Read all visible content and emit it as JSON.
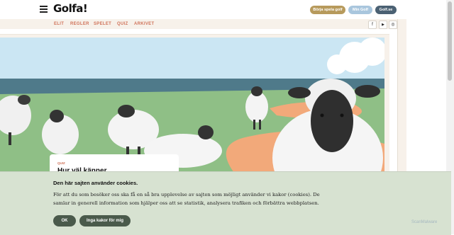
{
  "header": {
    "logo": "Golfa!",
    "buttons": [
      "Börja spela golf",
      "Min Golf",
      "Golf.se"
    ]
  },
  "subnav": {
    "links": [
      "ELIT",
      "REGLER",
      "SPELET",
      "QUIZ",
      "ARKIVET"
    ],
    "social": [
      {
        "icon": "facebook-icon",
        "glyph": "f"
      },
      {
        "icon": "youtube-icon",
        "glyph": "▶"
      },
      {
        "icon": "instagram-icon",
        "glyph": "◎"
      }
    ]
  },
  "article_card": {
    "label": "QUIZ",
    "title": "Hur väl känner"
  },
  "cookie_banner": {
    "title": "Den här sajten använder cookies.",
    "text_line1": "För att du som besöker oss ska få en så bra upplevelse av sajten som möjligt använder vi kakor (cookies). De",
    "text_line2": "samlar in generell information som hjälper oss att se statistik, analysera trafiken och förbättra webbplatsen.",
    "ok_label": "OK",
    "decline_label": "Inga kakor för mig"
  },
  "watermark": "ScanMalware",
  "colors": {
    "accent": "#d0735a",
    "gold": "#b79a5c",
    "cookie_bg": "#d7e2d1",
    "button_dark": "#4a5a4b"
  }
}
